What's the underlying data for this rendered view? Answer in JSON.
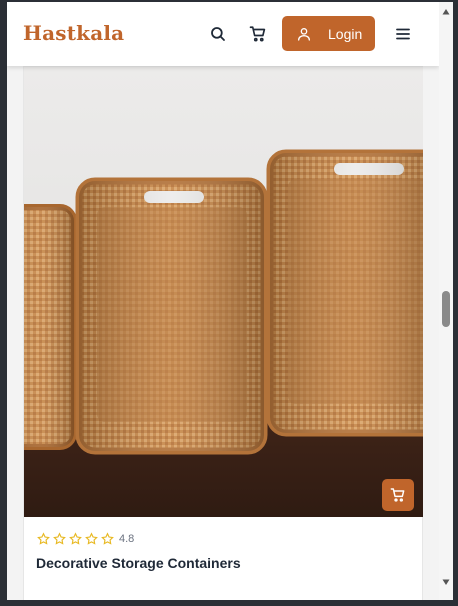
{
  "header": {
    "brand": "Hastkala",
    "login_label": "Login",
    "icons": [
      "search-icon",
      "cart-icon",
      "user-icon",
      "menu-icon"
    ]
  },
  "product": {
    "image_alt": "Woven rattan baskets",
    "rating": "4.8",
    "stars_total": 5,
    "title": "Decorative Storage Containers"
  },
  "colors": {
    "accent": "#c0652b",
    "star": "#e8b923",
    "text": "#1f2937"
  }
}
